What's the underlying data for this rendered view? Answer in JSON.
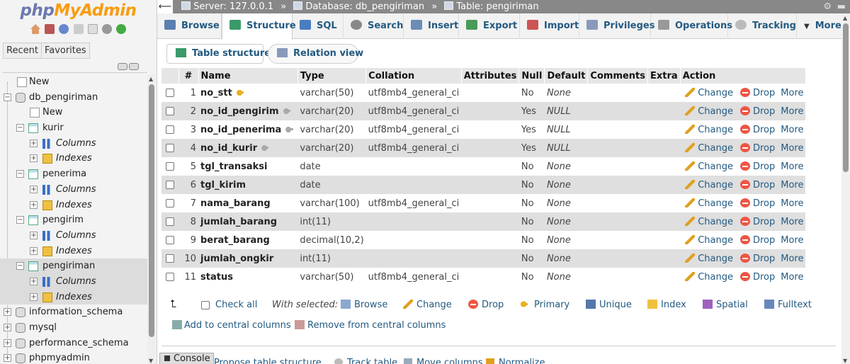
{
  "nav": {
    "logo_php": "php",
    "logo_my": "MyAdmin",
    "recent_tab": "Recent",
    "favorites_tab": "Favorites",
    "tree": {
      "new_root": "New",
      "db_pengiriman": "db_pengiriman",
      "new_table": "New",
      "tables": [
        {
          "name": "kurir",
          "columns": "Columns",
          "indexes": "Indexes"
        },
        {
          "name": "penerima",
          "columns": "Columns",
          "indexes": "Indexes"
        },
        {
          "name": "pengirim",
          "columns": "Columns",
          "indexes": "Indexes"
        },
        {
          "name": "pengiriman",
          "columns": "Columns",
          "indexes": "Indexes"
        }
      ],
      "other_dbs": [
        "information_schema",
        "mysql",
        "performance_schema",
        "phpmyadmin"
      ]
    }
  },
  "breadcrumb": {
    "server": "Server: 127.0.0.1",
    "database": "Database: db_pengiriman",
    "table": "Table: pengiriman",
    "separator": "»"
  },
  "tabs": [
    {
      "label": "Browse",
      "icon": "browse-icon"
    },
    {
      "label": "Structure",
      "icon": "structure-icon"
    },
    {
      "label": "SQL",
      "icon": "sql-icon"
    },
    {
      "label": "Search",
      "icon": "search-icon"
    },
    {
      "label": "Insert",
      "icon": "insert-icon"
    },
    {
      "label": "Export",
      "icon": "export-icon"
    },
    {
      "label": "Import",
      "icon": "import-icon"
    },
    {
      "label": "Privileges",
      "icon": "privileges-icon"
    },
    {
      "label": "Operations",
      "icon": "operations-icon"
    },
    {
      "label": "Tracking",
      "icon": "tracking-icon"
    },
    {
      "label": "More",
      "icon": "chevron-down-icon"
    }
  ],
  "subtabs": {
    "table_structure": "Table structure",
    "relation_view": "Relation view"
  },
  "table": {
    "headers": [
      "#",
      "Name",
      "Type",
      "Collation",
      "Attributes",
      "Null",
      "Default",
      "Comments",
      "Extra",
      "Action"
    ],
    "action_labels": {
      "change": "Change",
      "drop": "Drop",
      "more": "More"
    },
    "rows": [
      {
        "num": "1",
        "name": "no_stt",
        "key": "primary",
        "type": "varchar(50)",
        "collation": "utf8mb4_general_ci",
        "null": "No",
        "default": "None"
      },
      {
        "num": "2",
        "name": "no_id_pengirim",
        "key": "foreign",
        "type": "varchar(20)",
        "collation": "utf8mb4_general_ci",
        "null": "Yes",
        "default": "NULL"
      },
      {
        "num": "3",
        "name": "no_id_penerima",
        "key": "foreign",
        "type": "varchar(20)",
        "collation": "utf8mb4_general_ci",
        "null": "Yes",
        "default": "NULL"
      },
      {
        "num": "4",
        "name": "no_id_kurir",
        "key": "foreign",
        "type": "varchar(20)",
        "collation": "utf8mb4_general_ci",
        "null": "Yes",
        "default": "NULL"
      },
      {
        "num": "5",
        "name": "tgl_transaksi",
        "key": "",
        "type": "date",
        "collation": "",
        "null": "No",
        "default": "None"
      },
      {
        "num": "6",
        "name": "tgl_kirim",
        "key": "",
        "type": "date",
        "collation": "",
        "null": "No",
        "default": "None"
      },
      {
        "num": "7",
        "name": "nama_barang",
        "key": "",
        "type": "varchar(100)",
        "collation": "utf8mb4_general_ci",
        "null": "No",
        "default": "None"
      },
      {
        "num": "8",
        "name": "jumlah_barang",
        "key": "",
        "type": "int(11)",
        "collation": "",
        "null": "No",
        "default": "None"
      },
      {
        "num": "9",
        "name": "berat_barang",
        "key": "",
        "type": "decimal(10,2)",
        "collation": "",
        "null": "No",
        "default": "None"
      },
      {
        "num": "10",
        "name": "jumlah_ongkir",
        "key": "",
        "type": "int(11)",
        "collation": "",
        "null": "No",
        "default": "None"
      },
      {
        "num": "11",
        "name": "status",
        "key": "",
        "type": "varchar(50)",
        "collation": "utf8mb4_general_ci",
        "null": "No",
        "default": "None"
      }
    ]
  },
  "with_selected": {
    "check_all": "Check all",
    "label": "With selected:",
    "actions": [
      "Browse",
      "Change",
      "Drop",
      "Primary",
      "Unique",
      "Index",
      "Spatial",
      "Fulltext"
    ]
  },
  "central": {
    "add": "Add to central columns",
    "remove": "Remove from central columns"
  },
  "bottom": {
    "console": "Console",
    "links": [
      "Propose table structure",
      "Track table",
      "Move columns",
      "Normalize"
    ]
  }
}
